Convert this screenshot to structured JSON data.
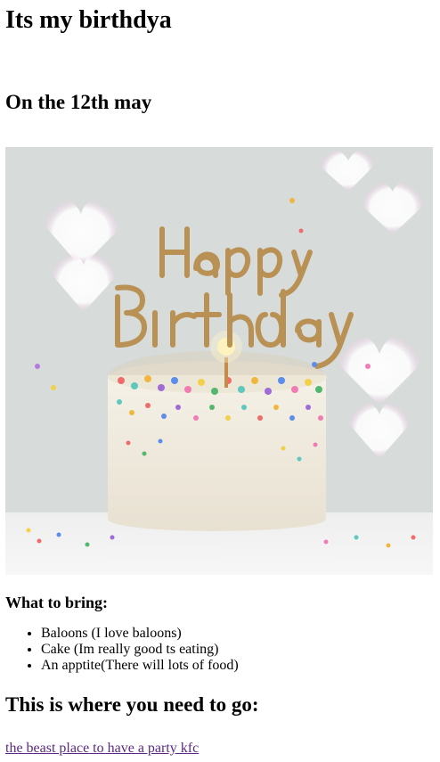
{
  "header": {
    "title": "Its my birthdya"
  },
  "subheader": {
    "date_text": "On the 12th may"
  },
  "hero_image": {
    "icon_name": "birthday-cake-image",
    "colors": {
      "background": "#d8dcdb",
      "cake": "#f3eee3",
      "topper": "#b99154"
    }
  },
  "bring_section": {
    "title": "What to bring:",
    "items": [
      "Baloons (I love baloons)",
      "Cake (Im really good ts eating)",
      "An apptite(There will lots of food)"
    ]
  },
  "location_section": {
    "title": "This is where you need to go:",
    "link_text": "the beast place to have a party kfc"
  }
}
